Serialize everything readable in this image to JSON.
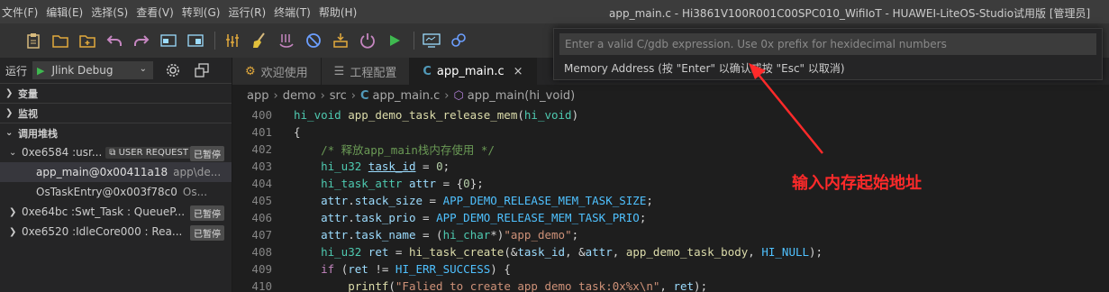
{
  "menu": {
    "items": [
      "文件(F)",
      "编辑(E)",
      "选择(S)",
      "查看(V)",
      "转到(G)",
      "运行(R)",
      "终端(T)",
      "帮助(H)"
    ]
  },
  "window_title": "app_main.c - Hi3861V100R001C00SPC010_WifiIoT - HUAWEI-LiteOS-Studio试用版 [管理员]",
  "toolbar": {
    "icons": [
      "clipboard-icon",
      "open-folder-icon",
      "new-folder-icon",
      "undo-icon",
      "redo-icon",
      "window-icon",
      "panel-icon",
      "build-icon",
      "clean-icon",
      "rebuild-icon",
      "stop-icon",
      "burn-icon",
      "power-icon",
      "run-icon",
      "monitor-icon",
      "debug-config-icon"
    ]
  },
  "run": {
    "label": "运行",
    "config": "Jlink Debug"
  },
  "sections": {
    "variables": "变量",
    "watch": "监视",
    "call_stack": "调用堆栈"
  },
  "call_stack": {
    "threads": [
      {
        "name": "0xe6584 :usr...",
        "request": "USER REQUEST",
        "status": "已暂停",
        "expanded": true
      },
      {
        "name": "0xe64bc :Swt_Task : QueueP...",
        "status": "已暂停",
        "expanded": false
      },
      {
        "name": "0xe6520 :IdleCore000 : Rea...",
        "status": "已暂停",
        "expanded": false
      }
    ],
    "frames": [
      {
        "fn": "app_main@0x00411a18",
        "src": "app\\de..."
      },
      {
        "fn": "OsTaskEntry@0x003f78c0",
        "src": "Os..."
      }
    ]
  },
  "tabs": [
    {
      "label": "欢迎使用",
      "active": false
    },
    {
      "label": "工程配置",
      "active": false
    },
    {
      "label": "app_main.c",
      "active": true
    }
  ],
  "breadcrumb": [
    "app",
    "demo",
    "src",
    "app_main.c",
    "app_main(hi_void)"
  ],
  "code": {
    "line_numbers": [
      "400",
      "401",
      "402",
      "403",
      "404",
      "405",
      "406",
      "407",
      "408",
      "409",
      "410"
    ]
  },
  "popup": {
    "placeholder": "Enter a valid C/gdb expression. Use 0x prefix for hexidecimal numbers",
    "message": "Memory Address (按 \"Enter\" 以确认或按 \"Esc\" 以取消)"
  },
  "annotation": "输入内存起始地址",
  "colors": {
    "annotation": "#ff2a2a",
    "accent_play": "#3fb950",
    "keyword": "#569cd6"
  }
}
